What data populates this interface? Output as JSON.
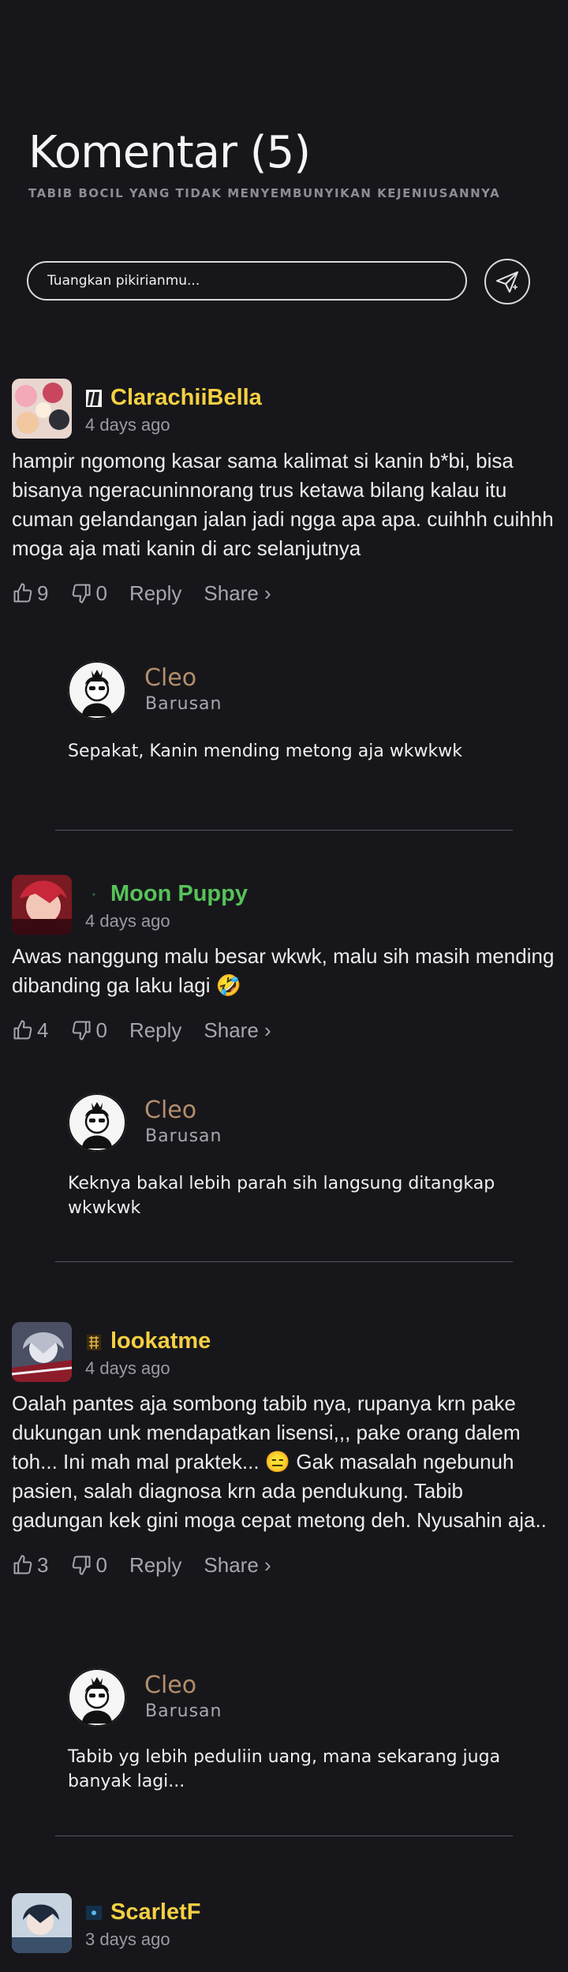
{
  "header": {
    "title": "Komentar (5)",
    "subtitle": "TABIB BOCIL YANG TIDAK MENYEMBUNYIKAN KEJENIUSANNYA"
  },
  "composer": {
    "placeholder": "Tuangkan pikirianmu...",
    "send_icon": "paper-plane-icon"
  },
  "comments": [
    {
      "user": "ClarachiiBella",
      "name_color": "#f5d042",
      "time": "4 days ago",
      "text": "hampir ngomong kasar sama kalimat si kanin b*bi, bisa bisanya ngeracuninnorang trus ketawa bilang kalau itu cuman gelandangan jalan jadi ngga apa apa. cuihhh cuihhh moga aja mati kanin di arc selanjutnya",
      "likes": "9",
      "dislikes": "0",
      "reply_label": "Reply",
      "share_label": "Share ›",
      "reply": {
        "user": "Cleo",
        "time": "Barusan",
        "text": "Sepakat, Kanin mending metong aja wkwkwk"
      }
    },
    {
      "user": "Moon Puppy",
      "name_color": "#57c35a",
      "time": "4 days ago",
      "text": "Awas nanggung malu besar wkwk, malu sih masih mending dibanding ga laku lagi 🤣",
      "likes": "4",
      "dislikes": "0",
      "reply_label": "Reply",
      "share_label": "Share ›",
      "reply": {
        "user": "Cleo",
        "time": "Barusan",
        "text": "Keknya bakal lebih parah sih langsung ditangkap wkwkwk"
      }
    },
    {
      "user": "lookatme",
      "name_color": "#f5d042",
      "time": "4 days ago",
      "text": "Oalah pantes aja sombong tabib nya, rupanya krn pake dukungan unk mendapatkan lisensi,,, pake orang dalem toh... Ini mah mal praktek... 😑 Gak masalah ngebunuh pasien, salah diagnosa krn ada pendukung. Tabib gadungan kek gini moga cepat metong deh. Nyusahin aja..",
      "likes": "3",
      "dislikes": "0",
      "reply_label": "Reply",
      "share_label": "Share ›",
      "reply": {
        "user": "Cleo",
        "time": "Barusan",
        "text": "Tabib yg lebih peduliin uang, mana sekarang juga banyak lagi..."
      }
    },
    {
      "user": "ScarletF",
      "name_color": "#f5d042",
      "time": "3 days ago"
    }
  ]
}
